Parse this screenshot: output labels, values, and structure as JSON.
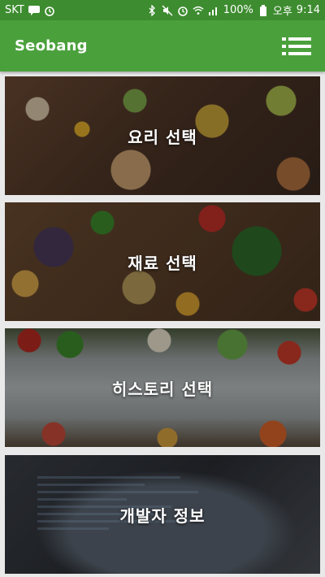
{
  "status_bar": {
    "carrier": "SKT",
    "battery": "100%",
    "ampm": "오후",
    "time": "9:14"
  },
  "app_bar": {
    "title": "Seobang",
    "menu_icon": "menu-icon"
  },
  "cards": [
    {
      "label": "요리 선택"
    },
    {
      "label": "재료 선택"
    },
    {
      "label": "히스토리 선택"
    },
    {
      "label": "개발자 정보"
    }
  ],
  "colors": {
    "status_bar": "#3e8c30",
    "app_bar": "#4aa13c",
    "background": "#e9e9e9"
  }
}
